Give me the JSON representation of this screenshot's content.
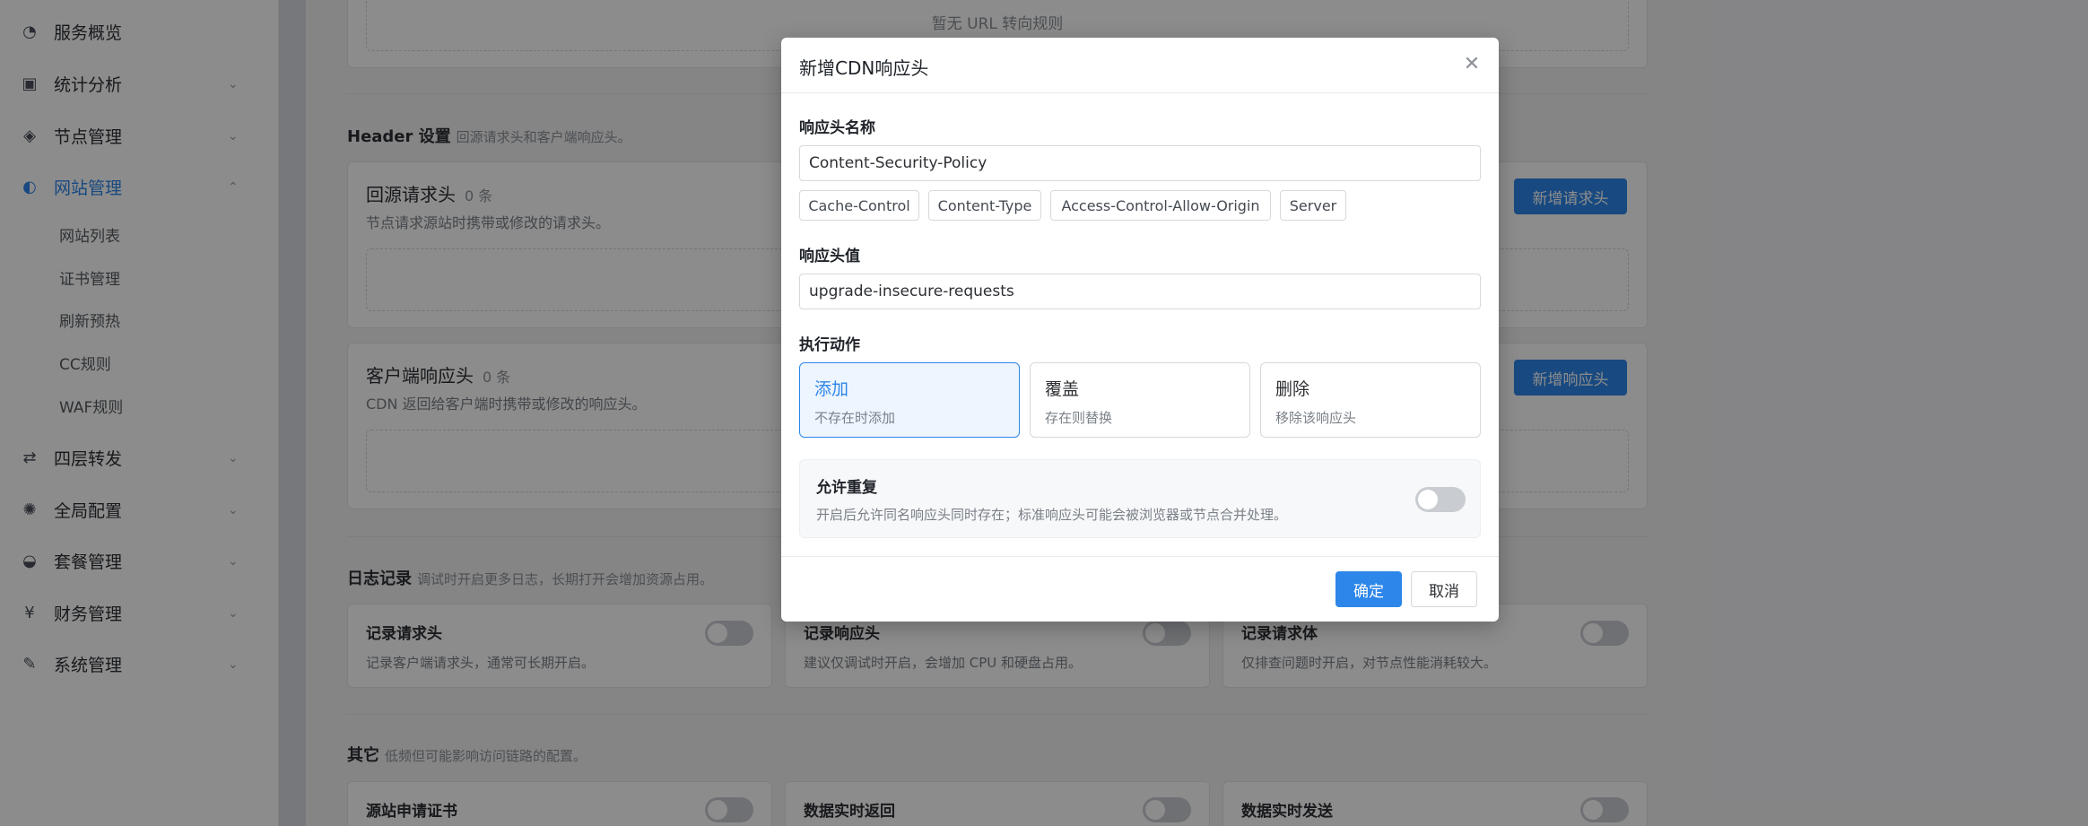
{
  "sidebar": {
    "items": [
      {
        "label": "服务概览",
        "icon": "dashboard-icon"
      },
      {
        "label": "统计分析",
        "icon": "chart-icon"
      },
      {
        "label": "节点管理",
        "icon": "layers-icon"
      },
      {
        "label": "网站管理",
        "icon": "globe-icon"
      },
      {
        "label": "四层转发",
        "icon": "forward-icon"
      },
      {
        "label": "全局配置",
        "icon": "gear-icon"
      },
      {
        "label": "套餐管理",
        "icon": "basket-icon"
      },
      {
        "label": "财务管理",
        "icon": "yuan-icon"
      },
      {
        "label": "系统管理",
        "icon": "wrench-icon"
      }
    ],
    "subitems": [
      "网站列表",
      "证书管理",
      "刷新预热",
      "CC规则",
      "WAF规则"
    ]
  },
  "main": {
    "url_redirect_empty": "暂无 URL 转向规则",
    "header_section": {
      "title": "Header 设置",
      "subtitle": "回源请求头和客户端响应头。"
    },
    "origin_headers": {
      "title": "回源请求头",
      "count": "0 条",
      "desc": "节点请求源站时携带或修改的请求头。",
      "button": "新增请求头"
    },
    "client_headers": {
      "title": "客户端响应头",
      "count": "0 条",
      "desc": "CDN 返回给客户端时携带或修改的响应头。",
      "button": "新增响应头"
    },
    "log_section": {
      "title": "日志记录",
      "subtitle": "调试时开启更多日志，长期打开会增加资源占用。"
    },
    "log_cards": [
      {
        "title": "记录请求头",
        "desc": "记录客户端请求头，通常可长期开启。"
      },
      {
        "title": "记录响应头",
        "desc": "建议仅调试时开启，会增加 CPU 和硬盘占用。"
      },
      {
        "title": "记录请求体",
        "desc": "仅排查问题时开启，对节点性能消耗较大。"
      }
    ],
    "other_section": {
      "title": "其它",
      "subtitle": "低频但可能影响访问链路的配置。"
    },
    "other_cards": [
      {
        "title": "源站申请证书"
      },
      {
        "title": "数据实时返回"
      },
      {
        "title": "数据实时发送"
      }
    ]
  },
  "modal": {
    "title": "新增CDN响应头",
    "name_label": "响应头名称",
    "name_value": "Content-Security-Policy",
    "presets": [
      "Cache-Control",
      "Content-Type",
      "Access-Control-Allow-Origin",
      "Server"
    ],
    "value_label": "响应头值",
    "value_value": "upgrade-insecure-requests",
    "action_label": "执行动作",
    "actions": [
      {
        "title": "添加",
        "desc": "不存在时添加",
        "selected": true
      },
      {
        "title": "覆盖",
        "desc": "存在则替换",
        "selected": false
      },
      {
        "title": "删除",
        "desc": "移除该响应头",
        "selected": false
      }
    ],
    "repeat_title": "允许重复",
    "repeat_desc": "开启后允许同名响应头同时存在；标准响应头可能会被浏览器或节点合并处理。",
    "repeat_enabled": false,
    "ok": "确定",
    "cancel": "取消"
  },
  "colors": {
    "accent": "#2d86e9",
    "overlay": "rgba(0,0,0,0.45)"
  }
}
